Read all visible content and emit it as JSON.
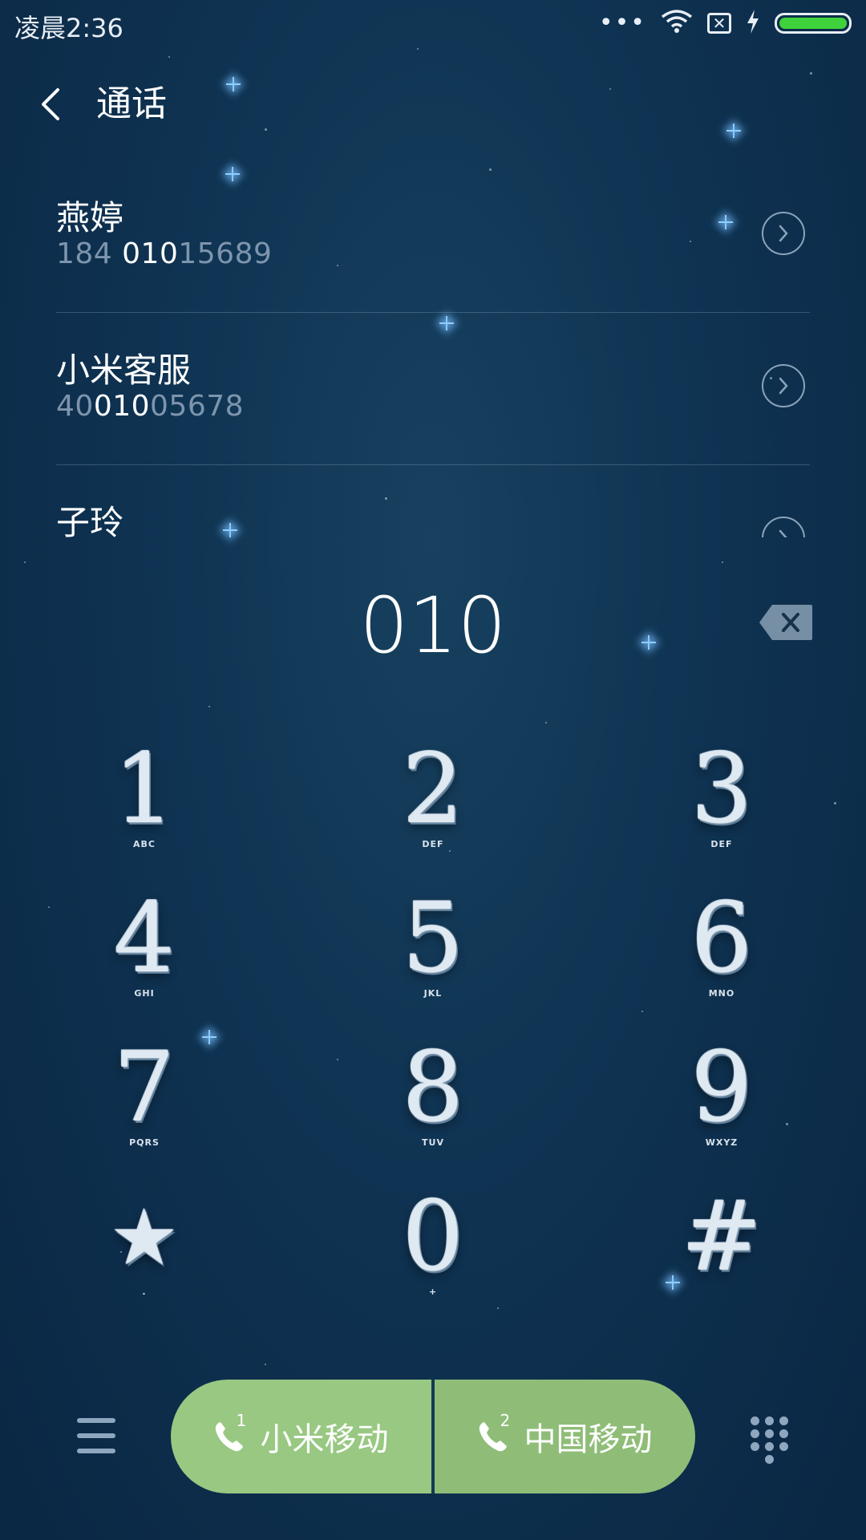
{
  "status_bar": {
    "time": "凌晨2:36",
    "dots": "•••",
    "sim_status": "✕"
  },
  "header": {
    "title": "通话"
  },
  "contacts": [
    {
      "name": "燕婷",
      "number_prefix": "184 ",
      "number_match": "010",
      "number_suffix": "15689"
    },
    {
      "name": "小米客服",
      "number_prefix": "40",
      "number_match": "010",
      "number_suffix": "05678"
    },
    {
      "name": "子玲",
      "number_prefix": "",
      "number_match": "",
      "number_suffix": ""
    }
  ],
  "dialer": {
    "dialed_number": "010"
  },
  "keypad": {
    "keys": [
      {
        "digit": "1",
        "letters": "ABC"
      },
      {
        "digit": "2",
        "letters": "DEF"
      },
      {
        "digit": "3",
        "letters": "DEF"
      },
      {
        "digit": "4",
        "letters": "GHI"
      },
      {
        "digit": "5",
        "letters": "JKL"
      },
      {
        "digit": "6",
        "letters": "MNO"
      },
      {
        "digit": "7",
        "letters": "PQRS"
      },
      {
        "digit": "8",
        "letters": "TUV"
      },
      {
        "digit": "9",
        "letters": "WXYZ"
      },
      {
        "digit": "★",
        "letters": "."
      },
      {
        "digit": "0",
        "letters": "+"
      },
      {
        "digit": "#",
        "letters": ""
      }
    ]
  },
  "bottom_bar": {
    "sim1_label": "小米移动",
    "sim1_index": "1",
    "sim2_label": "中国移动",
    "sim2_index": "2"
  },
  "colors": {
    "background": "#0f3352",
    "call_button": "#98c882",
    "battery": "#3fd23a",
    "number_dim": "#7d95ad"
  }
}
